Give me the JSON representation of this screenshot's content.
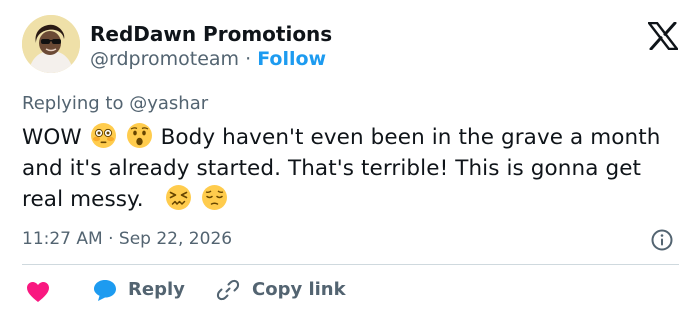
{
  "author": {
    "name": "RedDawn Promotions",
    "handle": "@rdpromoteam",
    "separator": "·",
    "follow_label": "Follow"
  },
  "reply_context": {
    "prefix": "Replying to",
    "handle": "@yashar"
  },
  "tweet": {
    "part1": "WOW",
    "part2": "Body haven't even been in the grave a month and it's already started. That's terrible! This is gonna get real messy.",
    "emojis": [
      "flushed-face",
      "astonished-face",
      "confounded-face",
      "pensive-face"
    ]
  },
  "meta": {
    "time": "11:27 AM",
    "separator": "·",
    "date": "Sep 22, 2026"
  },
  "actions": {
    "reply_label": "Reply",
    "copy_label": "Copy link"
  },
  "colors": {
    "accent": "#1d9bf0",
    "heart": "#f91880",
    "muted": "#536471",
    "text": "#0f1419",
    "divider": "#cfd9de"
  },
  "icons": [
    "x-logo-icon",
    "info-icon",
    "heart-icon",
    "reply-bubble-icon",
    "link-icon"
  ]
}
